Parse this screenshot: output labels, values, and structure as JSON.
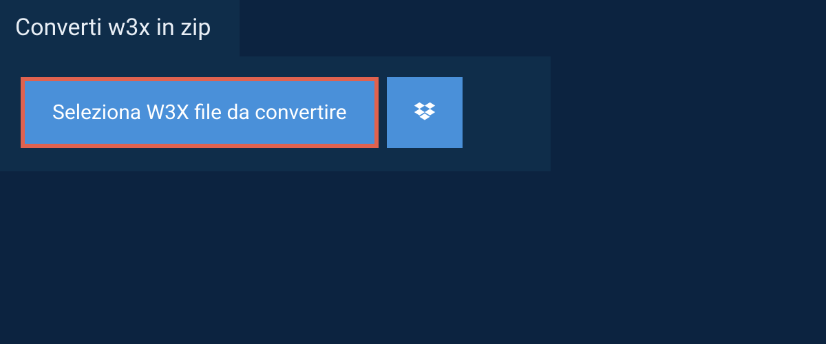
{
  "tab": {
    "label": "Converti w3x in zip"
  },
  "panel": {
    "select_button_label": "Seleziona W3X file da convertire"
  },
  "colors": {
    "background": "#0c2340",
    "panel": "#0f2d4a",
    "button": "#4a90d9",
    "highlight_border": "#e0624f",
    "text": "#ffffff"
  }
}
